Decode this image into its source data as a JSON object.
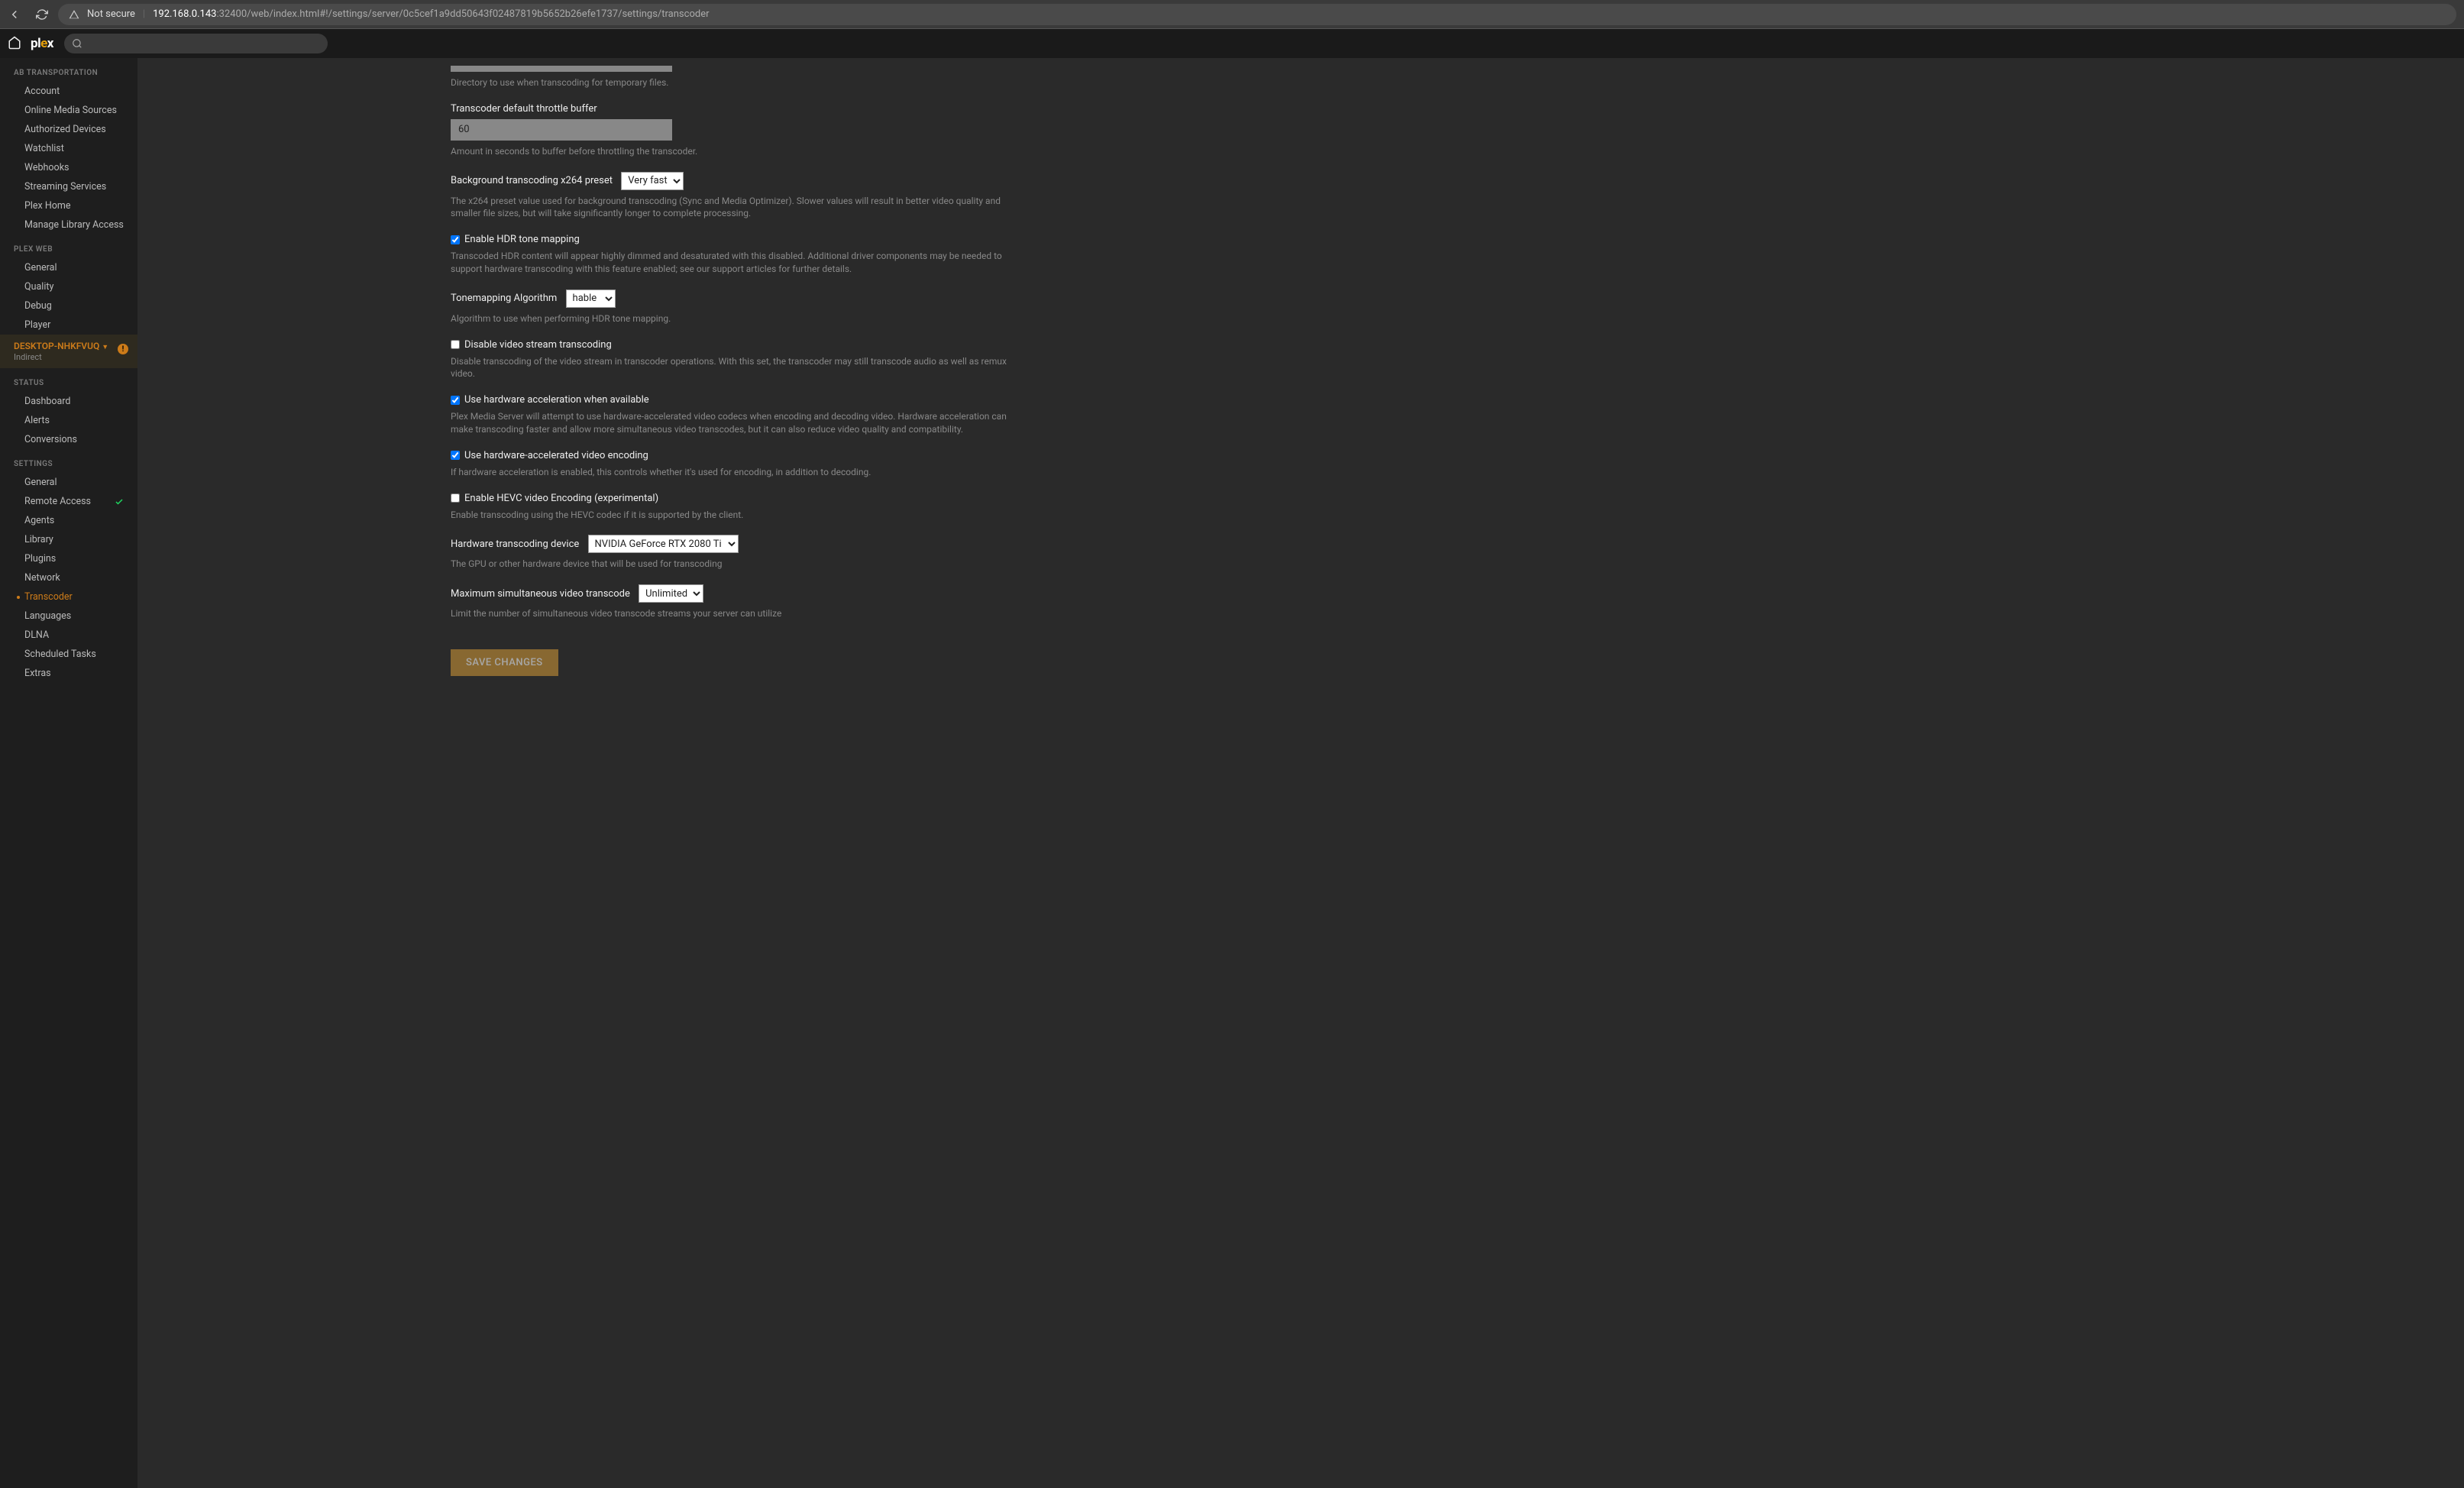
{
  "browser": {
    "not_secure_label": "Not secure",
    "url_host": "192.168.0.143",
    "url_rest": ":32400/web/index.html#!/settings/server/0c5cef1a9dd50643f02487819b5652b26efe1737/settings/transcoder"
  },
  "logo": {
    "p1": "pl",
    "p2": "e",
    "p3": "x"
  },
  "sidebar": {
    "section1_title": "AB TRANSPORTATION",
    "section1_items": [
      {
        "label": "Account"
      },
      {
        "label": "Online Media Sources"
      },
      {
        "label": "Authorized Devices"
      },
      {
        "label": "Watchlist"
      },
      {
        "label": "Webhooks"
      },
      {
        "label": "Streaming Services"
      },
      {
        "label": "Plex Home"
      },
      {
        "label": "Manage Library Access"
      }
    ],
    "section2_title": "PLEX WEB",
    "section2_items": [
      {
        "label": "General"
      },
      {
        "label": "Quality"
      },
      {
        "label": "Debug"
      },
      {
        "label": "Player"
      }
    ],
    "server_name": "DESKTOP-NHKFVUQ",
    "server_sub": "Indirect",
    "server_warn": "!",
    "section3_title": "STATUS",
    "section3_items": [
      {
        "label": "Dashboard"
      },
      {
        "label": "Alerts"
      },
      {
        "label": "Conversions"
      }
    ],
    "section4_title": "SETTINGS",
    "section4_items": [
      {
        "label": "General"
      },
      {
        "label": "Remote Access",
        "check": true
      },
      {
        "label": "Agents"
      },
      {
        "label": "Library"
      },
      {
        "label": "Plugins"
      },
      {
        "label": "Network"
      },
      {
        "label": "Transcoder",
        "active": true
      },
      {
        "label": "Languages"
      },
      {
        "label": "DLNA"
      },
      {
        "label": "Scheduled Tasks"
      },
      {
        "label": "Extras"
      }
    ]
  },
  "form": {
    "temp_dir_help": "Directory to use when transcoding for temporary files.",
    "throttle_label": "Transcoder default throttle buffer",
    "throttle_value": "60",
    "throttle_help": "Amount in seconds to buffer before throttling the transcoder.",
    "bg_preset_label": "Background transcoding x264 preset",
    "bg_preset_value": "Very fast",
    "bg_preset_help": "The x264 preset value used for background transcoding (Sync and Media Optimizer). Slower values will result in better video quality and smaller file sizes, but will take significantly longer to complete processing.",
    "hdr_label": "Enable HDR tone mapping",
    "hdr_checked": true,
    "hdr_help": "Transcoded HDR content will appear highly dimmed and desaturated with this disabled. Additional driver components may be needed to support hardware transcoding with this feature enabled; see our support articles for further details.",
    "tonemap_label": "Tonemapping Algorithm",
    "tonemap_value": "hable",
    "tonemap_help": "Algorithm to use when performing HDR tone mapping.",
    "disable_video_label": "Disable video stream transcoding",
    "disable_video_checked": false,
    "disable_video_help": "Disable transcoding of the video stream in transcoder operations. With this set, the transcoder may still transcode audio as well as remux video.",
    "hw_accel_label": "Use hardware acceleration when available",
    "hw_accel_checked": true,
    "hw_accel_help": "Plex Media Server will attempt to use hardware-accelerated video codecs when encoding and decoding video. Hardware acceleration can make transcoding faster and allow more simultaneous video transcodes, but it can also reduce video quality and compatibility.",
    "hw_encode_label": "Use hardware-accelerated video encoding",
    "hw_encode_checked": true,
    "hw_encode_help": "If hardware acceleration is enabled, this controls whether it's used for encoding, in addition to decoding.",
    "hevc_label": "Enable HEVC video Encoding (experimental)",
    "hevc_checked": false,
    "hevc_help": "Enable transcoding using the HEVC codec if it is supported by the client.",
    "hw_device_label": "Hardware transcoding device",
    "hw_device_value": "NVIDIA GeForce RTX 2080 Ti",
    "hw_device_help": "The GPU or other hardware device that will be used for transcoding",
    "max_transcode_label": "Maximum simultaneous video transcode",
    "max_transcode_value": "Unlimited",
    "max_transcode_help": "Limit the number of simultaneous video transcode streams your server can utilize",
    "save_label": "SAVE CHANGES"
  }
}
